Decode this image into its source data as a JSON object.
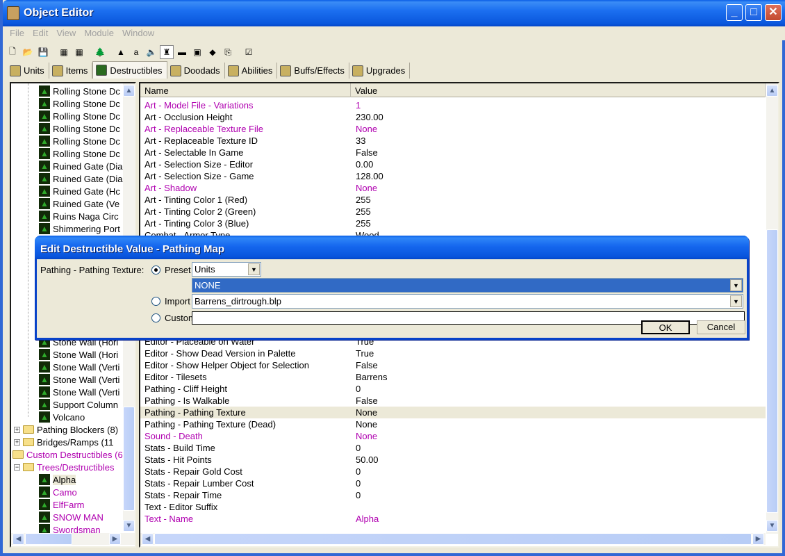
{
  "window": {
    "title": "Object Editor",
    "controls": {
      "minimize": "_",
      "maximize": "□",
      "close": "✕"
    }
  },
  "menu": [
    "File",
    "Edit",
    "View",
    "Module",
    "Window"
  ],
  "toolbar": [
    {
      "icon": "new-file-icon",
      "glyph": "🗋"
    },
    {
      "icon": "open-folder-icon",
      "glyph": "📂"
    },
    {
      "icon": "save-icon",
      "glyph": "💾"
    },
    {
      "icon": "copy-icon",
      "glyph": "▦"
    },
    {
      "icon": "paste-icon",
      "glyph": "▦"
    },
    {
      "icon": "destructible-tree-icon",
      "glyph": "🌲"
    },
    {
      "icon": "terrain-icon",
      "glyph": "▲"
    },
    {
      "icon": "text-a-icon",
      "glyph": "a"
    },
    {
      "icon": "sound-icon",
      "glyph": "🔈"
    },
    {
      "icon": "unit-icon",
      "glyph": "♜"
    },
    {
      "icon": "item-icon",
      "glyph": "▬"
    },
    {
      "icon": "ai-icon",
      "glyph": "▣"
    },
    {
      "icon": "object-icon",
      "glyph": "◆"
    },
    {
      "icon": "import-icon",
      "glyph": "⎘"
    },
    {
      "icon": "test-map-icon",
      "glyph": "☑"
    }
  ],
  "tabs": [
    {
      "label": "Units",
      "icon": "units-icon"
    },
    {
      "label": "Items",
      "icon": "items-icon"
    },
    {
      "label": "Destructibles",
      "icon": "destructibles-icon",
      "active": true
    },
    {
      "label": "Doodads",
      "icon": "doodads-icon"
    },
    {
      "label": "Abilities",
      "icon": "abilities-icon"
    },
    {
      "label": "Buffs/Effects",
      "icon": "buffs-icon"
    },
    {
      "label": "Upgrades",
      "icon": "upgrades-icon"
    }
  ],
  "tree": {
    "top_items": [
      "Rolling Stone Dc",
      "Rolling Stone Dc",
      "Rolling Stone Dc",
      "Rolling Stone Dc",
      "Rolling Stone Dc",
      "Rolling Stone Dc",
      "Ruined Gate (Dia",
      "Ruined Gate (Dia",
      "Ruined Gate (Hc",
      "Ruined Gate (Ve",
      "Ruins Naga Circ",
      "Shimmering Port"
    ],
    "bottom_items": [
      "Stone Wall (Hori",
      "Stone Wall (Hori",
      "Stone Wall (Verti",
      "Stone Wall (Verti",
      "Stone Wall (Verti",
      "Support Column",
      "Volcano"
    ],
    "folders": [
      {
        "label": "Pathing Blockers (8)",
        "expander": "+"
      },
      {
        "label": "Bridges/Ramps (11",
        "expander": "+"
      }
    ],
    "custom_root": "Custom Destructibles (6",
    "custom_folder": "Trees/Destructibles",
    "custom_items": [
      {
        "label": "Alpha",
        "selected": true
      },
      {
        "label": "Camo"
      },
      {
        "label": "ElfFarm"
      },
      {
        "label": "SNOW MAN"
      },
      {
        "label": "Swordsman"
      }
    ]
  },
  "grid": {
    "headers": {
      "name": "Name",
      "value": "Value"
    },
    "rows_top": [
      {
        "name": "Art - Model File - Variations",
        "value": "1",
        "custom": true
      },
      {
        "name": "Art - Occlusion Height",
        "value": "230.00"
      },
      {
        "name": "Art - Replaceable Texture File",
        "value": "None",
        "custom": true
      },
      {
        "name": "Art - Replaceable Texture ID",
        "value": "33"
      },
      {
        "name": "Art - Selectable In Game",
        "value": "False"
      },
      {
        "name": "Art - Selection Size - Editor",
        "value": "0.00"
      },
      {
        "name": "Art - Selection Size - Game",
        "value": "128.00"
      },
      {
        "name": "Art - Shadow",
        "value": "None",
        "custom": true
      },
      {
        "name": "Art - Tinting Color 1 (Red)",
        "value": "255"
      },
      {
        "name": "Art - Tinting Color 2 (Green)",
        "value": "255"
      },
      {
        "name": "Art - Tinting Color 3 (Blue)",
        "value": "255"
      },
      {
        "name": "Combat - Armor Type",
        "value": "Wood"
      }
    ],
    "rows_bottom": [
      {
        "name": "Editor - Placeable on Water",
        "value": "True"
      },
      {
        "name": "Editor - Show Dead Version in Palette",
        "value": "True"
      },
      {
        "name": "Editor - Show Helper Object for Selection",
        "value": "False"
      },
      {
        "name": "Editor - Tilesets",
        "value": "Barrens"
      },
      {
        "name": "Pathing - Cliff Height",
        "value": "0"
      },
      {
        "name": "Pathing - Is Walkable",
        "value": "False"
      },
      {
        "name": "Pathing - Pathing Texture",
        "value": "None",
        "highlighted": true
      },
      {
        "name": "Pathing - Pathing Texture (Dead)",
        "value": "None"
      },
      {
        "name": "Sound - Death",
        "value": "None",
        "custom": true
      },
      {
        "name": "Stats - Build Time",
        "value": "0"
      },
      {
        "name": "Stats - Hit Points",
        "value": "50.00"
      },
      {
        "name": "Stats - Repair Gold Cost",
        "value": "0"
      },
      {
        "name": "Stats - Repair Lumber Cost",
        "value": "0"
      },
      {
        "name": "Stats - Repair Time",
        "value": "0"
      },
      {
        "name": "Text - Editor Suffix",
        "value": ""
      },
      {
        "name": "Text - Name",
        "value": "Alpha",
        "custom": true
      }
    ]
  },
  "dialog": {
    "title": "Edit Destructible Value - Pathing Map",
    "field_label": "Pathing - Pathing Texture:",
    "preset_label": "Preset",
    "preset_category": "Units",
    "preset_value": "NONE",
    "import_label": "Import",
    "import_value": "Barrens_dirtrough.blp",
    "custom_label": "Custom",
    "custom_value": "",
    "selected_option": "Preset",
    "ok": "OK",
    "cancel": "Cancel"
  },
  "colors": {
    "custom_text": "#b000b0",
    "accent": "#0a5fe6",
    "selection": "#316ac5"
  }
}
